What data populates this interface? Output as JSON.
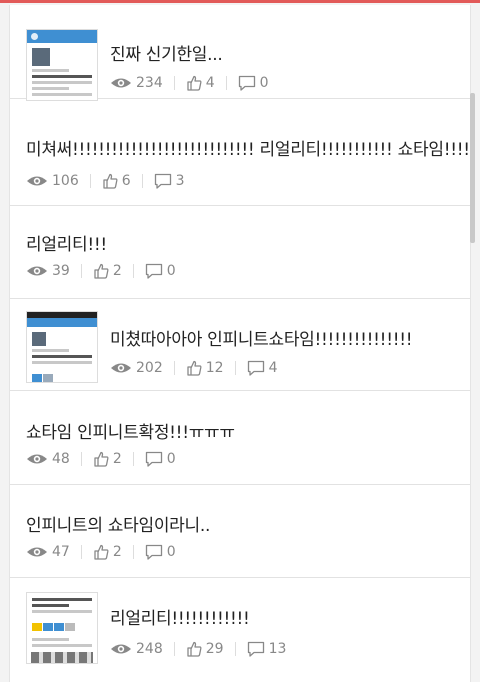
{
  "items": [
    {
      "title": "진짜 신기한일...",
      "views": "234",
      "likes": "4",
      "comments": "0",
      "has_thumb": true,
      "thumb_kind": "twitter"
    },
    {
      "title": "미쳐써!!!!!!!!!!!!!!!!!!!!!!!!!!!! 리얼리티!!!!!!!!!!! 쇼타임!!!!!!!!!!!!!",
      "views": "106",
      "likes": "6",
      "comments": "3",
      "has_thumb": false
    },
    {
      "title": "리얼리티!!!",
      "views": "39",
      "likes": "2",
      "comments": "0",
      "has_thumb": false
    },
    {
      "title": "미쳤따아아아 인피니트쇼타임!!!!!!!!!!!!!!!",
      "views": "202",
      "likes": "12",
      "comments": "4",
      "has_thumb": true,
      "thumb_kind": "twitter-mobile"
    },
    {
      "title": "쇼타임 인피니트확정!!!ㅠㅠㅠ",
      "views": "48",
      "likes": "2",
      "comments": "0",
      "has_thumb": false
    },
    {
      "title": "인피니트의 쇼타임이라니..",
      "views": "47",
      "likes": "2",
      "comments": "0",
      "has_thumb": false
    },
    {
      "title": "리얼리티!!!!!!!!!!!!",
      "views": "248",
      "likes": "29",
      "comments": "13",
      "has_thumb": true,
      "thumb_kind": "news"
    }
  ],
  "icons": {
    "views": "eye-icon",
    "likes": "thumbs-up-icon",
    "comments": "comment-icon"
  },
  "colors": {
    "accent": "#e25a59",
    "text": "#222222",
    "meta": "#888888",
    "twitter_blue": "#3f8fd2"
  }
}
